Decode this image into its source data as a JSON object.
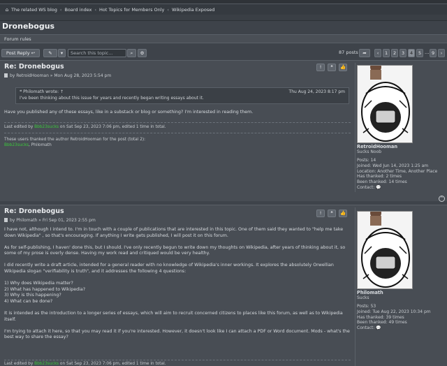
{
  "breadcrumb": {
    "items": [
      "The related WS blog",
      "Board index",
      "Hot Topics for Members Only",
      "Wikipedia Exposed"
    ]
  },
  "forum": {
    "title": "Dronebogus",
    "rules_label": "Forum rules"
  },
  "toolbar": {
    "post_reply_label": "Post Reply",
    "search_placeholder": "Search this topic...",
    "post_count": "87 posts",
    "pages": [
      "1",
      "2",
      "3",
      "4",
      "5",
      "…",
      "9"
    ],
    "active_page": "4"
  },
  "posts": [
    {
      "title": "Re: Dronebogus",
      "meta": "by RetroidHooman » Mon Aug 28, 2023 5:54 pm",
      "quote": {
        "author": "Philomath wrote: ↑",
        "date": "Thu Aug 24, 2023 8:17 pm",
        "text": "I've been thinking about this issue for years and recently began writing essays about it."
      },
      "body": [
        "Have you published any of these essays, like in a substack or blog or something? I'm interested in reading them."
      ],
      "edit_prefix": "Last edited by",
      "edit_user": "Bbb23sucks",
      "edit_suffix": "on Sat Sep 23, 2023 7:06 pm, edited 1 time in total.",
      "thanks_line": "These users thanked the author RetroidHooman for the post (total 2):",
      "thanks_user1": "Bbb23sucks",
      "thanks_rest": ", Philomath",
      "profile": {
        "name": "RetroidHooman",
        "rank": "Sucks Noob",
        "posts": "Posts: 14",
        "joined": "Joined: Wed Jun 14, 2023 1:25 am",
        "location": "Location: Another Time, Another Place",
        "has_thanked": "Has thanked: 2 times",
        "been_thanked": "Been thanked: 14 times",
        "contact": "Contact:"
      }
    },
    {
      "title": "Re: Dronebogus",
      "meta": "by Philomath » Fri Sep 01, 2023 2:55 pm",
      "body": [
        "I have not, although I intend to. I'm in touch with a couple of publications that are interested in this topic. One of them said they wanted to \"help me take down Wikipedia\" , so that's encouraging. If anything I write gets published, I will post it on this forum.",
        "As for self-publishing, I haven' done this, but I should. I've only recently begun to write down my thoughts on Wikipedia, after years of thinking about it, so some of my prose is overly dense. Having my work read and critiqued would be very healthy.",
        "I did recently write a draft article, intended for a general reader with no knowledge of Wikipedia's inner workings. It explores the absolutely Orwellian Wikipedia slogan \"verifiability is truth\", and it addresses the following 4 questions:",
        "1) Why does Wikipedia matter?",
        "2) What has happened to Wikipedia?",
        "3) Why is this happening?",
        "4) What can be done?",
        "It is intended as the introduction to a longer series of essays, which will aim to recruit concerned citizens to places like this forum, as well as to Wikipedia itself.",
        "I'm trying to attach it here, so that you may read it if you're interested. However, it doesn't look like I can attach a PDF or Word document. Mods - what's the best way to share the essay?"
      ],
      "edit_prefix": "Last edited by",
      "edit_user": "Bbb23sucks",
      "edit_suffix": "on Sat Sep 23, 2023 7:06 pm, edited 1 time in total.",
      "profile": {
        "name": "Philomath",
        "rank": "Sucks",
        "posts": "Posts: 53",
        "joined": "Joined: Tue Aug 22, 2023 10:34 pm",
        "has_thanked": "Has thanked: 39 times",
        "been_thanked": "Been thanked: 49 times",
        "contact": "Contact:"
      }
    }
  ],
  "colors": {
    "page_bg": "#3e434a",
    "post_bg": "#484d54",
    "username_green": "#3cc83c"
  }
}
